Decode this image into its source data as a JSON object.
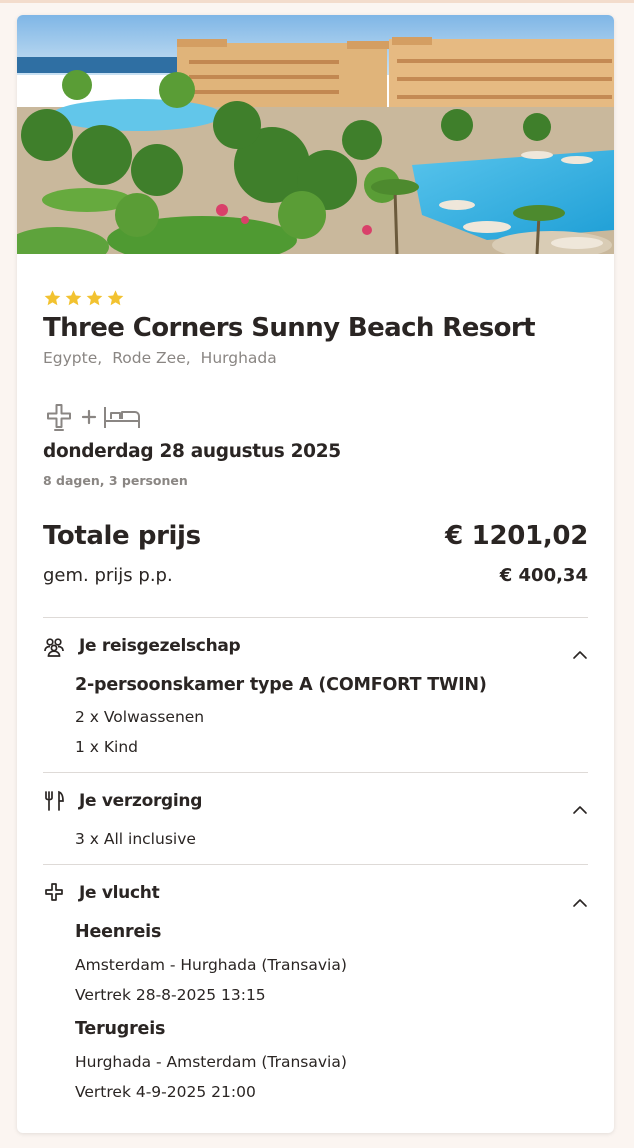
{
  "hotel": {
    "star_count": 4,
    "star_color": "#f2c230",
    "name": "Three Corners Sunny Beach Resort",
    "location": [
      "Egypte,",
      "Rode Zee,",
      "Hurghada"
    ]
  },
  "trip": {
    "package_icons": [
      "plane-icon",
      "plus-icon",
      "bed-icon"
    ],
    "date": "donderdag 28 augustus 2025",
    "details": "8 dagen, 3 personen"
  },
  "price": {
    "total_label": "Totale prijs",
    "total_value": "€ 1201,02",
    "pp_label": "gem. prijs p.p.",
    "pp_value": "€ 400,34"
  },
  "sections": {
    "party": {
      "icon": "group-icon",
      "title": "Je reisgezelschap",
      "room": "2-persoonskamer type A (COMFORT TWIN)",
      "adults": "2 x Volwassenen",
      "children": "1 x Kind"
    },
    "board": {
      "icon": "cutlery-icon",
      "title": "Je verzorging",
      "value": "3 x All inclusive"
    },
    "flight": {
      "icon": "plane-icon",
      "title": "Je vlucht",
      "outbound_label": "Heenreis",
      "outbound_route": "Amsterdam - Hurghada (Transavia)",
      "outbound_departure": "Vertrek 28-8-2025 13:15",
      "return_label": "Terugreis",
      "return_route": "Hurghada - Amsterdam (Transavia)",
      "return_departure": "Vertrek 4-9-2025 21:00"
    }
  }
}
